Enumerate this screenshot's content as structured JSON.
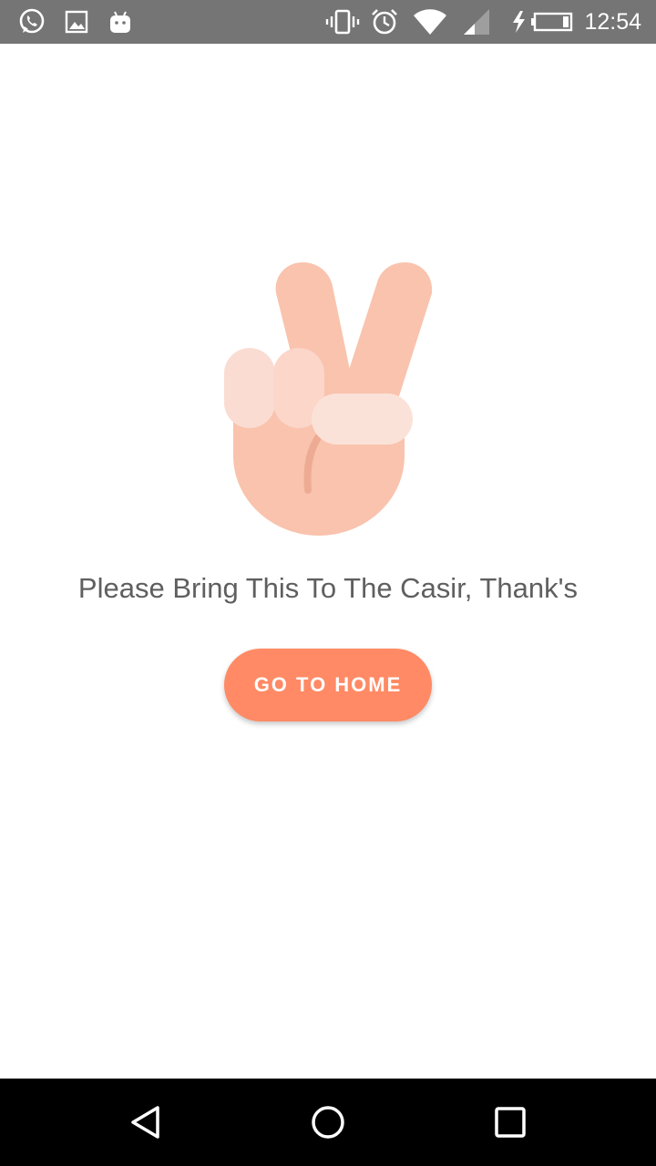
{
  "status_bar": {
    "time": "12:54",
    "left_icons": [
      "whatsapp-icon",
      "gallery-icon",
      "android-icon"
    ],
    "right_icons": [
      "vibrate-icon",
      "alarm-icon",
      "wifi-icon",
      "signal-icon",
      "battery-charging-icon"
    ],
    "background": "#757575"
  },
  "main": {
    "illustration": "peace-hand-illustration",
    "message": "Please Bring This To The Casir, Thank's",
    "button_label": "GO TO HOME",
    "accent_color": "#ff8a65"
  },
  "nav_bar": {
    "buttons": [
      "back",
      "home",
      "recents"
    ]
  }
}
